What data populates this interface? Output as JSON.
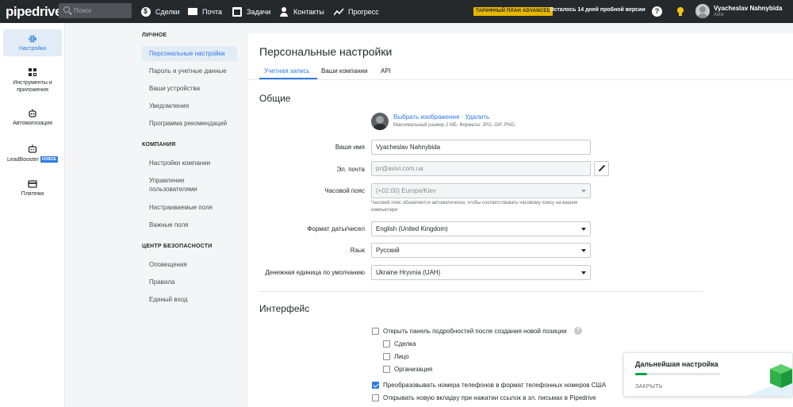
{
  "topbar": {
    "logo": "pipedrive",
    "search_placeholder": "Поиск",
    "nav": [
      {
        "label": "Сделки",
        "icon": "deals-icon"
      },
      {
        "label": "Почта",
        "icon": "mail-icon"
      },
      {
        "label": "Задачи",
        "icon": "calendar-icon"
      },
      {
        "label": "Контакты",
        "icon": "contacts-icon"
      },
      {
        "label": "Прогресс",
        "icon": "progress-icon"
      }
    ],
    "plan_badge": "ТАРИФНЫЙ ПЛАН ADVANCED",
    "trial_text": "Осталось 14 дней пробной версии",
    "help": "?",
    "user_name": "Vyacheslav Nahnybida",
    "company": "Avivi"
  },
  "leftnav": [
    {
      "label": "Настройки",
      "icon": "gear-icon",
      "active": true
    },
    {
      "label": "Инструменты и приложения",
      "icon": "tools-icon",
      "active": false
    },
    {
      "label": "Автоматизация",
      "icon": "automation-icon",
      "active": false
    },
    {
      "label": "LeadBooster",
      "badge": "НОВОЕ",
      "icon": "leadbooster-icon",
      "active": false
    },
    {
      "label": "Платежи",
      "icon": "billing-icon",
      "active": false
    }
  ],
  "subnav": {
    "sections": [
      {
        "title": "ЛИЧНОЕ",
        "items": [
          "Персональные настройки",
          "Пароль и учетные данные",
          "Ваши устройства",
          "Уведомления",
          "Программа рекомендаций"
        ]
      },
      {
        "title": "КОМПАНИЯ",
        "items": [
          "Настройки компании",
          "Управление пользователями",
          "Настраиваемые поля",
          "Важные поля"
        ]
      },
      {
        "title": "ЦЕНТР БЕЗОПАСНОСТИ",
        "items": [
          "Оповещения",
          "Правила",
          "Единый вход"
        ]
      }
    ],
    "active_item": "Персональные настройки"
  },
  "main": {
    "title": "Персональные настройки",
    "tabs": [
      "Учетная запись",
      "Ваши компании",
      "API"
    ],
    "active_tab": "Учетная запись",
    "general": {
      "title": "Общие",
      "choose_image": "Выбрать изображение",
      "sep": " · ",
      "delete": "Удалить",
      "image_hint": "Максимальный размер 2 МБ. Форматы: JPG, GIF, PNG.",
      "name_label": "Ваше имя",
      "name_value": "Vyacheslav Nahnybida",
      "email_label": "Эл. почта",
      "email_value": "pr@avivi.com.ua",
      "tz_label": "Часовой пояс",
      "tz_value": "(+02:00) Europe/Kiev",
      "tz_hint": "Часовой пояс обновляется автоматически, чтобы соответствовать часовому поясу на вашем компьютере",
      "date_label": "Формат даты/чисел",
      "date_value": "English (United Kingdom)",
      "lang_label": "Язык",
      "lang_value": "Русский",
      "currency_label": "Денежная единица по умолчанию",
      "currency_value": "Ukraine Hryvnia (UAH)"
    },
    "interface": {
      "title": "Интерфейс",
      "open_details": "Открыть панель подробностей после создания новой позиции",
      "open_details_checked": false,
      "sub_options": [
        {
          "label": "Сделка",
          "checked": false
        },
        {
          "label": "Лицо",
          "checked": false
        },
        {
          "label": "Организация",
          "checked": false
        }
      ],
      "convert_phone": "Преобразовывать номера телефонов в формат телефонных номеров США",
      "convert_phone_checked": true,
      "open_new_tab": "Открывать новую вкладку при нажатии ссылок в эл. письмах в Pipedrive",
      "open_new_tab_checked": false
    }
  },
  "setup_panel": {
    "title": "Дальнейшая настройка",
    "progress": 0.14,
    "close": "ЗАКРЫТЬ"
  },
  "colors": {
    "accent": "#317ae2",
    "topbar": "#26292c",
    "badge": "#e6b700",
    "green": "#08a742"
  }
}
